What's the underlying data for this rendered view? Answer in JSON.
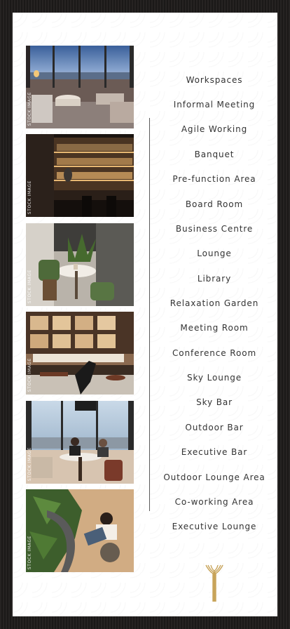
{
  "photo_label": "STOCK IMAGE",
  "menu": {
    "items": [
      "Workspaces",
      "Informal Meeting",
      "Agile Working",
      "Banquet",
      "Pre-function Area",
      "Board Room",
      "Business Centre",
      "Lounge",
      "Library",
      "Relaxation Garden",
      "Meeting Room",
      "Conference Room",
      "Sky Lounge",
      "Sky Bar",
      "Outdoor Bar",
      "Executive Bar",
      "Outdoor Lounge Area",
      "Co-working Area",
      "Executive Lounge"
    ]
  },
  "colors": {
    "frame": "#1f1d1c",
    "card": "#ffffff",
    "text": "#333333",
    "gold": "#c8a45a"
  }
}
